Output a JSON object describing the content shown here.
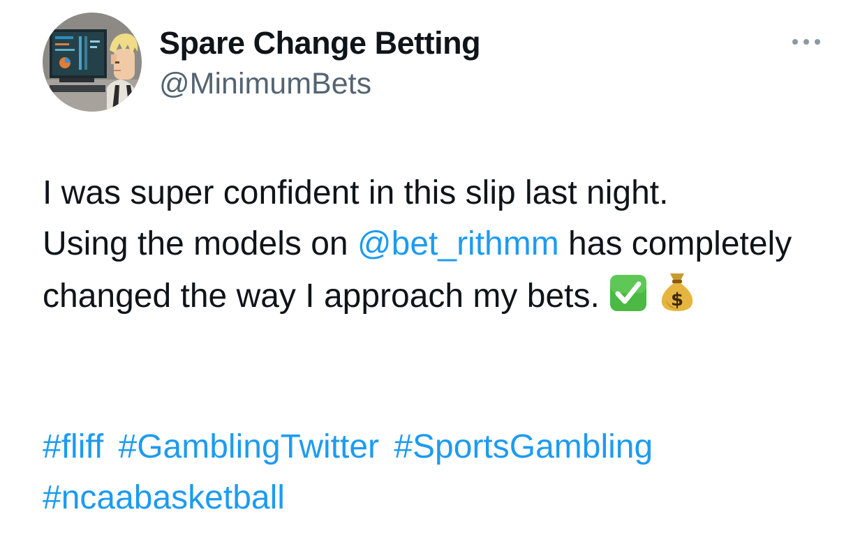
{
  "author": {
    "display_name": "Spare Change Betting",
    "handle": "@MinimumBets",
    "avatar_icon": "pixel-art-person-at-computer-avatar"
  },
  "menu": {
    "icon": "more-horizontal-icon"
  },
  "tweet": {
    "text_line1": "I was super confident in this slip last night.",
    "text_using": "Using the models on ",
    "mention": "@bet_rithmm",
    "text_after_mention": " has completely changed the way I approach my bets. ",
    "emoji_1": "check-mark-button-emoji",
    "emoji_2": "money-bag-emoji"
  },
  "hashtags": [
    "#fliff",
    "#GamblingTwitter",
    "#SportsGambling",
    "#ncaabasketball"
  ],
  "colors": {
    "link": "#1d9bf0",
    "text": "#0f1419",
    "secondary": "#536471"
  }
}
